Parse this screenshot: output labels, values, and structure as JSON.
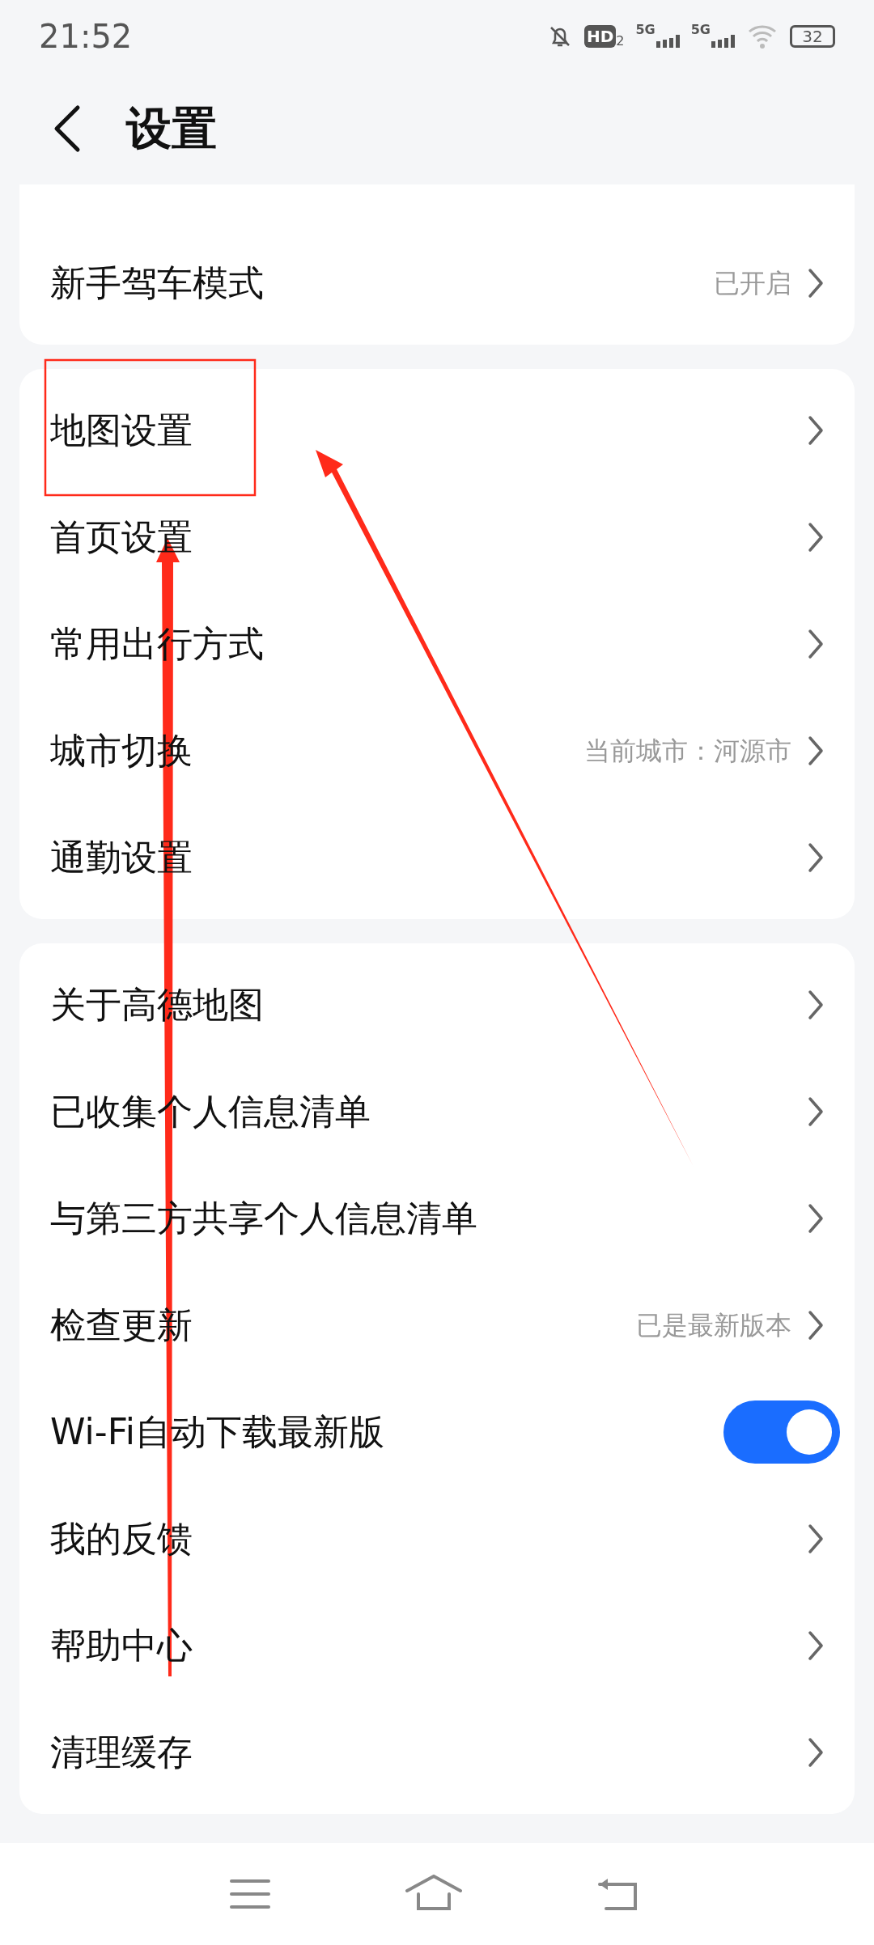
{
  "status_bar": {
    "time": "21:52",
    "hd": "HD",
    "hd_sim": "2",
    "networks": [
      "5G",
      "5G"
    ],
    "battery": "32"
  },
  "header": {
    "title": "设置"
  },
  "groups": [
    {
      "items": [
        {
          "kind": "link",
          "label": "新手驾车模式",
          "value": "已开启"
        }
      ]
    },
    {
      "items": [
        {
          "kind": "link",
          "label": "地图设置"
        },
        {
          "kind": "link",
          "label": "首页设置"
        },
        {
          "kind": "link",
          "label": "常用出行方式"
        },
        {
          "kind": "link",
          "label": "城市切换",
          "value": "当前城市：河源市"
        },
        {
          "kind": "link",
          "label": "通勤设置"
        }
      ]
    },
    {
      "items": [
        {
          "kind": "link",
          "label": "关于高德地图"
        },
        {
          "kind": "link",
          "label": "已收集个人信息清单"
        },
        {
          "kind": "link",
          "label": "与第三方共享个人信息清单"
        },
        {
          "kind": "link",
          "label": "检查更新",
          "value": "已是最新版本"
        },
        {
          "kind": "toggle",
          "label": "Wi-Fi自动下载最新版",
          "on": true
        },
        {
          "kind": "link",
          "label": "我的反馈"
        },
        {
          "kind": "link",
          "label": "帮助中心"
        },
        {
          "kind": "link",
          "label": "清理缓存"
        }
      ]
    }
  ]
}
